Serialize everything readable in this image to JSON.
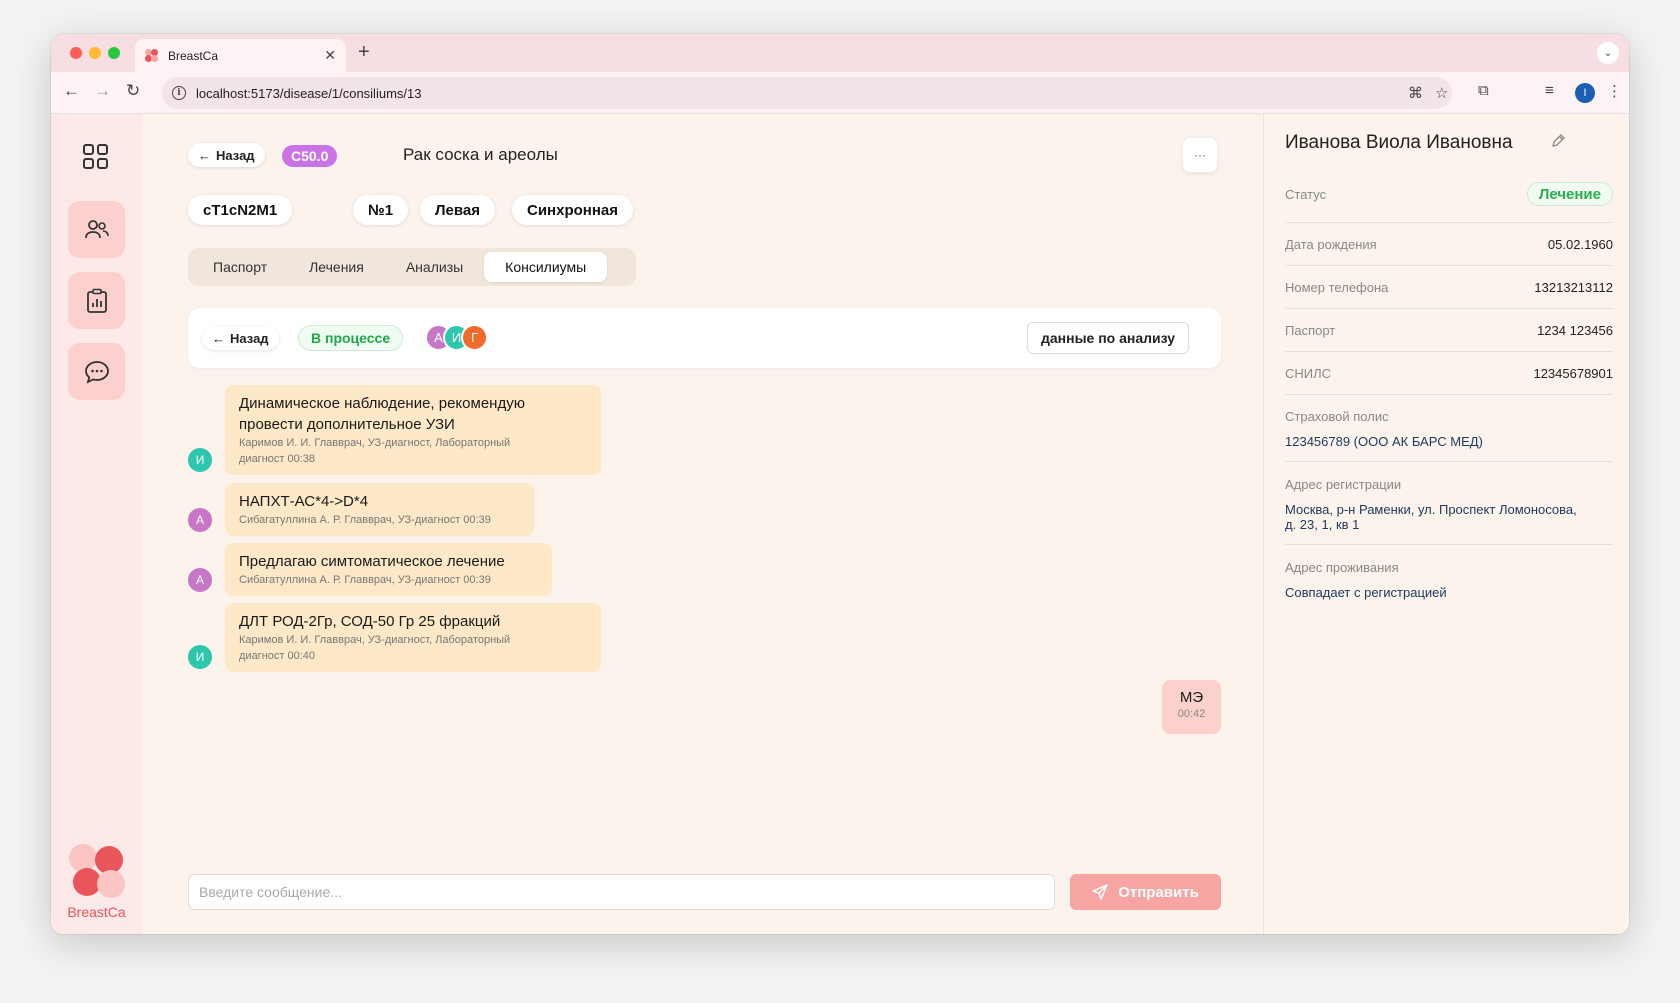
{
  "browser": {
    "tab_title": "BreastCa",
    "new_tab": "+",
    "url": "localhost:5173/disease/1/consiliums/13",
    "profile_initial": "I"
  },
  "sidebar": {
    "brand": "BreastCa"
  },
  "header": {
    "back_label": "Назад",
    "code": "C50.0",
    "title": "Рак соска и ареолы",
    "more": "···"
  },
  "chips": [
    "cT1cN2M1",
    "№1",
    "Левая",
    "Синхронная"
  ],
  "tabs": [
    "Паспорт",
    "Лечения",
    "Анализы",
    "Консилиумы"
  ],
  "consilium": {
    "back_label": "Назад",
    "status": "В процессе",
    "participants": [
      "А",
      "И",
      "Г"
    ],
    "analysis_button": "данные по анализу"
  },
  "messages": [
    {
      "avatar": "И",
      "text_lines": [
        "Динамическое наблюдение, рекомендую",
        "провести дополнительное УЗИ"
      ],
      "meta_lines": [
        "Каримов И. И. Главврач, УЗ-диагност, Лабораторный",
        "диагност 00:38"
      ]
    },
    {
      "avatar": "А",
      "text_lines": [
        "НАПХТ-АС*4->D*4"
      ],
      "meta_lines": [
        "Сибагатуллина А. Р. Главврач, УЗ-диагност 00:39"
      ]
    },
    {
      "avatar": "А",
      "text_lines": [
        "Предлагаю симтоматическое лечение"
      ],
      "meta_lines": [
        "Сибагатуллина А. Р. Главврач, УЗ-диагност 00:39"
      ]
    },
    {
      "avatar": "И",
      "text_lines": [
        "ДЛТ РОД-2Гр, СОД-50 Гр 25 фракций"
      ],
      "meta_lines": [
        "Каримов И. И. Главврач, УЗ-диагност, Лабораторный",
        "диагност 00:40"
      ]
    }
  ],
  "own_message": {
    "text": "МЭ",
    "time": "00:42"
  },
  "composer": {
    "placeholder": "Введите сообщение...",
    "send_label": "Отправить"
  },
  "patient": {
    "name": "Иванова Виола Ивановна",
    "status_label": "Статус",
    "status_value": "Лечение",
    "dob_label": "Дата рождения",
    "dob_value": "05.02.1960",
    "phone_label": "Номер телефона",
    "phone_value": "13213213112",
    "passport_label": "Паспорт",
    "passport_value": "1234 123456",
    "snils_label": "СНИЛС",
    "snils_value": "12345678901",
    "policy_label": "Страховой полис",
    "policy_value": "123456789 (ООО АК БАРС МЕД)",
    "reg_label": "Адрес регистрации",
    "reg_value_lines": [
      "Москва, р-н Раменки, ул. Проспект Ломоносова,",
      "д. 23, 1, кв 1"
    ],
    "live_label": "Адрес проживания",
    "live_value": "Совпадает с регистрацией"
  },
  "colors": {
    "accent": "#f7a5a3",
    "code_badge": "#c873e6",
    "status_green": "#1fa84a",
    "message_bg": "#fde8c8",
    "avatar_teal": "#2cc7ad",
    "avatar_purple": "#c678c6",
    "avatar_orange": "#f26b2a"
  }
}
